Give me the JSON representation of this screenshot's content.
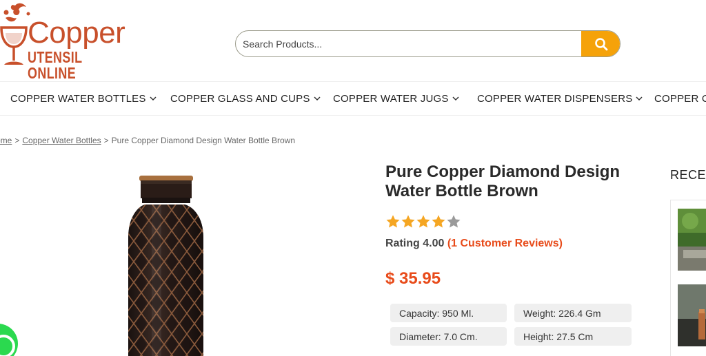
{
  "logo": {
    "word1": "Copper",
    "word2": "UTENSIL ONLINE",
    "brand_color": "#c8502b"
  },
  "search": {
    "placeholder": "Search Products...",
    "value": "",
    "button_color": "#f5a20a",
    "icon": "search-icon"
  },
  "nav": {
    "items": [
      {
        "label": "COPPER WATER BOTTLES"
      },
      {
        "label": "COPPER GLASS AND CUPS"
      },
      {
        "label": "COPPER WATER JUGS"
      },
      {
        "label": "COPPER WATER DISPENSERS"
      },
      {
        "label": "COPPER CA"
      }
    ]
  },
  "breadcrumb": {
    "home": "ome",
    "category": "Copper Water Bottles",
    "separator": ">",
    "current": "Pure Copper Diamond Design Water Bottle Brown"
  },
  "product": {
    "title": "Pure Copper Diamond Design Water Bottle Brown",
    "rating_value": 4,
    "rating_max": 5,
    "rating_text": "Rating 4.00",
    "reviews_text": "(1 Customer Reviews)",
    "price": "$ 35.95",
    "accent_color": "#e84b1a",
    "star_color": "#f5a623",
    "specs": [
      {
        "text": "Capacity: 950 Ml."
      },
      {
        "text": "Weight: 226.4 Gm"
      },
      {
        "text": "Diameter: 7.0 Cm."
      },
      {
        "text": "Height: 27.5 Cm"
      }
    ]
  },
  "sidebar": {
    "recent_title": "RECEN"
  },
  "floating": {
    "whatsapp_icon": "whatsapp-icon"
  }
}
